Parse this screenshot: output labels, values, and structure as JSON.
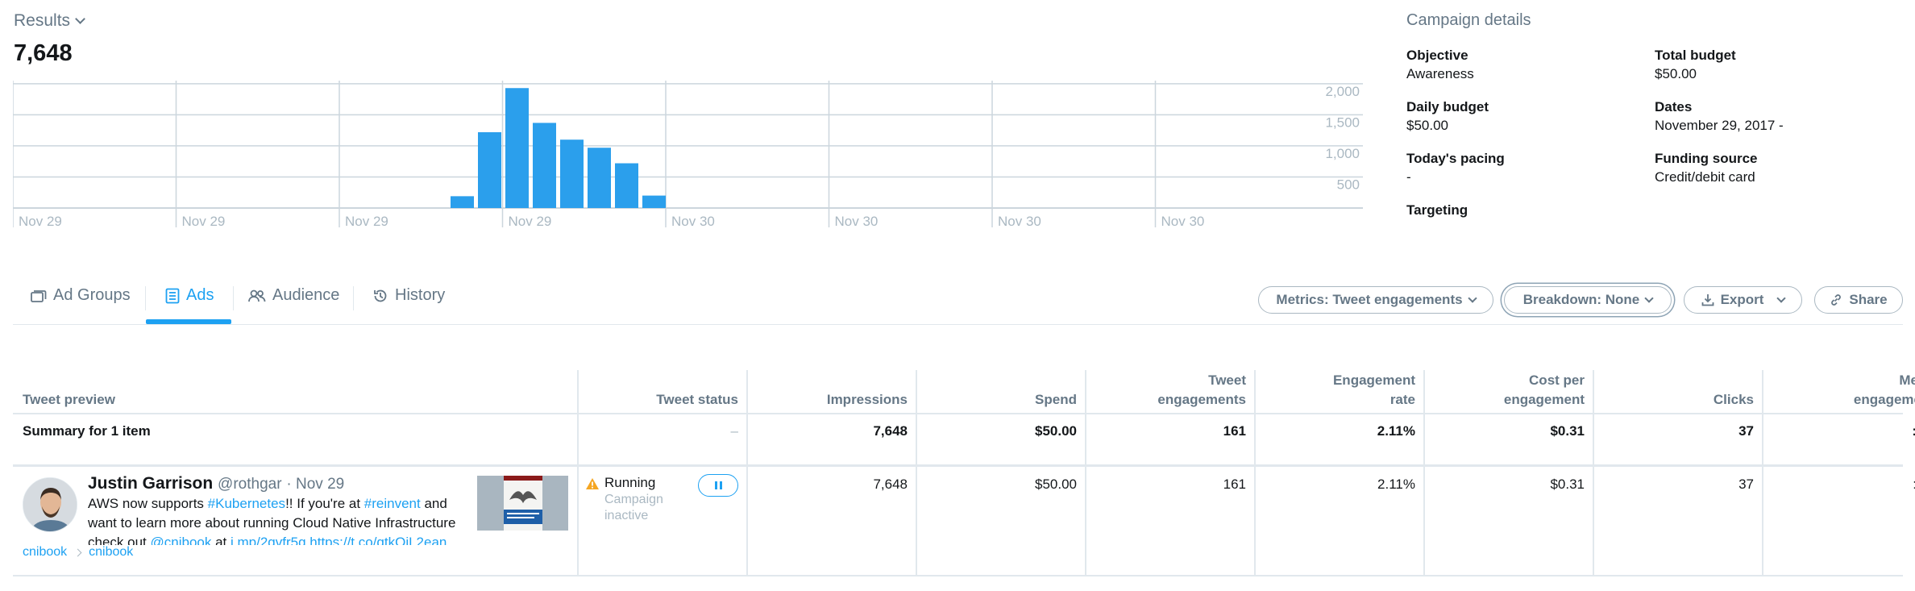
{
  "results": {
    "label": "Results",
    "value": "7,648"
  },
  "chart_data": {
    "type": "bar",
    "x": [
      "Nov 29",
      "Nov 29",
      "Nov 29",
      "Nov 29",
      "Nov 29",
      "Nov 29",
      "Nov 29",
      "Nov 29",
      "Nov 30"
    ],
    "values": [
      190,
      1220,
      1930,
      1370,
      1100,
      970,
      720,
      200
    ],
    "x_tick_labels": [
      "Nov 29",
      "Nov 29",
      "Nov 29",
      "Nov 29",
      "Nov 30",
      "Nov 30",
      "Nov 30",
      "Nov 30"
    ],
    "y_tick_labels": [
      "2,000",
      "1,500",
      "1,000",
      "500"
    ],
    "y_ticks": [
      2000,
      1500,
      1000,
      500
    ],
    "ylim": [
      0,
      2000
    ],
    "grid": true,
    "color": "#2b9fec"
  },
  "campaign_details": {
    "title": "Campaign details",
    "objective": {
      "label": "Objective",
      "value": "Awareness"
    },
    "total_budget": {
      "label": "Total budget",
      "value": "$50.00"
    },
    "daily_budget": {
      "label": "Daily budget",
      "value": "$50.00"
    },
    "dates": {
      "label": "Dates",
      "value": "November 29, 2017 -"
    },
    "todays_pacing": {
      "label": "Today's pacing",
      "value": "-"
    },
    "funding_source": {
      "label": "Funding source",
      "value": "Credit/debit card"
    },
    "targeting": {
      "label": "Targeting"
    }
  },
  "tabs": {
    "ad_groups": "Ad Groups",
    "ads": "Ads",
    "audience": "Audience",
    "history": "History",
    "active": "Ads"
  },
  "actions": {
    "metrics": "Metrics: Tweet engagements",
    "breakdown": "Breakdown: None",
    "export": "Export",
    "share": "Share"
  },
  "table": {
    "headers": {
      "tweet_preview": "Tweet preview",
      "tweet_status": "Tweet status",
      "impressions": "Impressions",
      "spend": "Spend",
      "tweet_engagements_1": "Tweet",
      "tweet_engagements_2": "engagements",
      "engagement_rate_1": "Engagement",
      "engagement_rate_2": "rate",
      "cost_per_engagement_1": "Cost per",
      "cost_per_engagement_2": "engagement",
      "clicks": "Clicks",
      "media_engagements_1": "Me",
      "media_engagements_2": "engageme"
    },
    "summary": {
      "label": "Summary for 1 item",
      "status": "–",
      "impressions": "7,648",
      "spend": "$50.00",
      "tweet_engagements": "161",
      "engagement_rate": "2.11%",
      "cost_per_engagement": "$0.31",
      "clicks": "37",
      "media_engagements": ":"
    },
    "row": {
      "name": "Justin Garrison",
      "handle": "@rothgar",
      "date": "· Nov 29",
      "text_1": "AWS now supports ",
      "hashtag_1": "#Kubernetes",
      "text_2": "!! If you're at ",
      "hashtag_2": "#reinvent",
      "text_3": " and want to learn more about running Cloud Native Infrastructure check out ",
      "mention": "@cnibook",
      "text_4": " at ",
      "link_1": "j.mp/2gvfr5g",
      "text_5": " ",
      "link_2": "https://t.co/qtkOjL2ean",
      "crumb_1": "cnibook",
      "crumb_2": "cnibook",
      "status": "Running",
      "status_sub": "Campaign inactive",
      "impressions": "7,648",
      "spend": "$50.00",
      "tweet_engagements": "161",
      "engagement_rate": "2.11%",
      "cost_per_engagement": "$0.31",
      "clicks": "37",
      "media_engagements": ":"
    }
  }
}
